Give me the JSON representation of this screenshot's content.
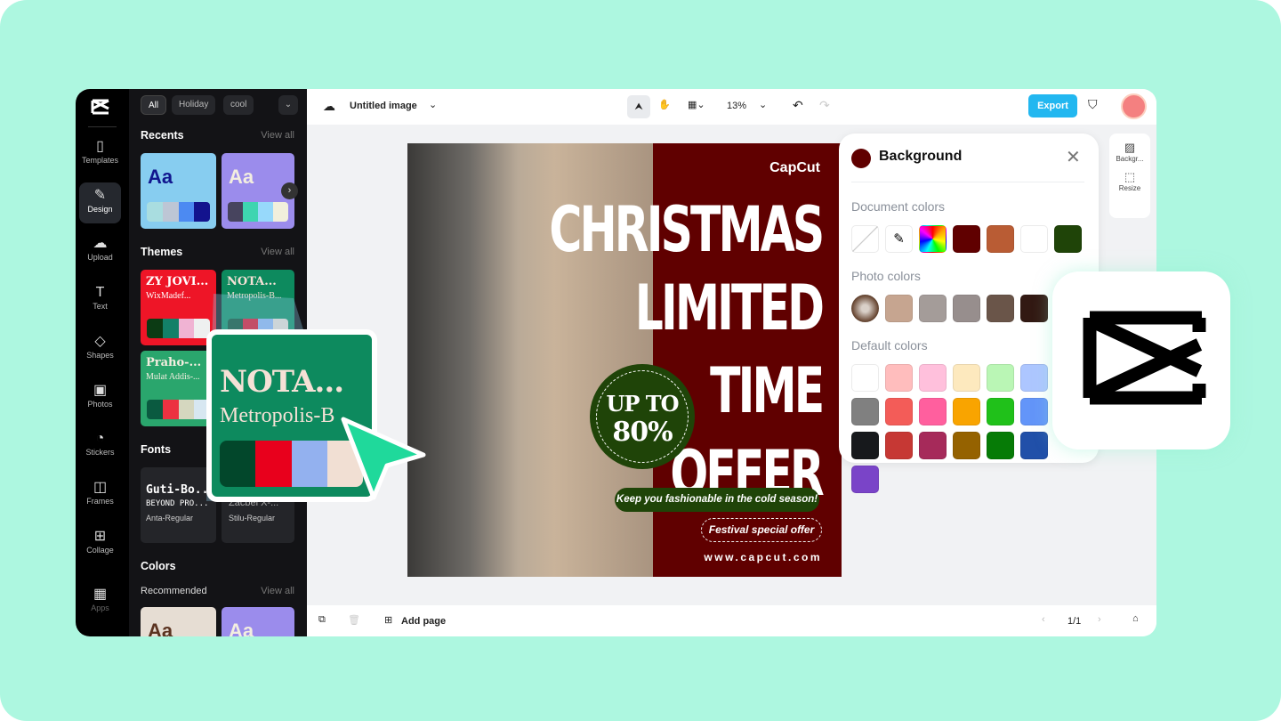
{
  "sidebar": {
    "items": [
      {
        "label": "Templates",
        "icon": "templates-icon"
      },
      {
        "label": "Design",
        "icon": "design-icon",
        "active": true
      },
      {
        "label": "Upload",
        "icon": "upload-icon"
      },
      {
        "label": "Text",
        "icon": "text-icon"
      },
      {
        "label": "Shapes",
        "icon": "shapes-icon"
      },
      {
        "label": "Photos",
        "icon": "photos-icon"
      },
      {
        "label": "Stickers",
        "icon": "stickers-icon"
      },
      {
        "label": "Frames",
        "icon": "frames-icon"
      },
      {
        "label": "Collage",
        "icon": "collage-icon"
      },
      {
        "label": "Apps",
        "icon": "apps-icon"
      }
    ]
  },
  "panel": {
    "chips": [
      "All",
      "Holiday",
      "cool"
    ],
    "recents": "Recents",
    "themes": "Themes",
    "fonts": "Fonts",
    "colors": "Colors",
    "recommended": "Recommended",
    "view_all": "View all",
    "aa": "Aa",
    "theme_cards": [
      {
        "title": "ZY JOVI...",
        "sub": "WixMadef..."
      },
      {
        "title": "NOTA...",
        "sub": "Metropolis-B..."
      },
      {
        "title": "Praho-...",
        "sub": "Mulat Addis-..."
      }
    ],
    "font_cards": [
      {
        "l1": "Guti-Bo...",
        "l2": "BEYOND PRO...",
        "l3": "Anta-Regular"
      },
      {
        "l1": "Zacbel X-...",
        "l3": "Stilu-Regular"
      }
    ],
    "zoomed_theme": {
      "title": "NOTA...",
      "sub": "Metropolis-B"
    }
  },
  "topbar": {
    "title": "Untitled image",
    "zoom": "13%",
    "export": "Export"
  },
  "bottombar": {
    "add_page": "Add page",
    "page": "1/1"
  },
  "poster": {
    "brand": "CapCut",
    "lines": [
      "CHRISTMAS",
      "LIMITED",
      "TIME",
      "OFFER"
    ],
    "badge1": "UP TO",
    "badge2": "80%",
    "tagline": "Keep you fashionable in the cold season!",
    "festival": "Festival special offer",
    "url": "www.capcut.com"
  },
  "bg_panel": {
    "title": "Background",
    "selected": "#600000",
    "document_label": "Document colors",
    "document_colors": [
      "#600000",
      "#b95c34",
      "#ffffff",
      "#1f4408"
    ],
    "photo_label": "Photo colors",
    "photo_colors": [
      "#c6a590",
      "#a49c99",
      "#978e8d",
      "#6a5549",
      "#321913"
    ],
    "default_label": "Default colors",
    "default_colors": [
      "#ffffff",
      "#ffbdbd",
      "#ffc0dc",
      "#fde9be",
      "#baf6b5",
      "#adc6ff",
      "#808080",
      "#f35c58",
      "#ff5f9e",
      "#f9a400",
      "#20c11a",
      "#6395f9",
      "#17191c",
      "#c63834",
      "#a62a5a",
      "#956200",
      "#067b06",
      "#2150a9",
      "#7a44c8"
    ]
  },
  "mini_panel": {
    "background": "Backgr...",
    "resize": "Resize"
  }
}
